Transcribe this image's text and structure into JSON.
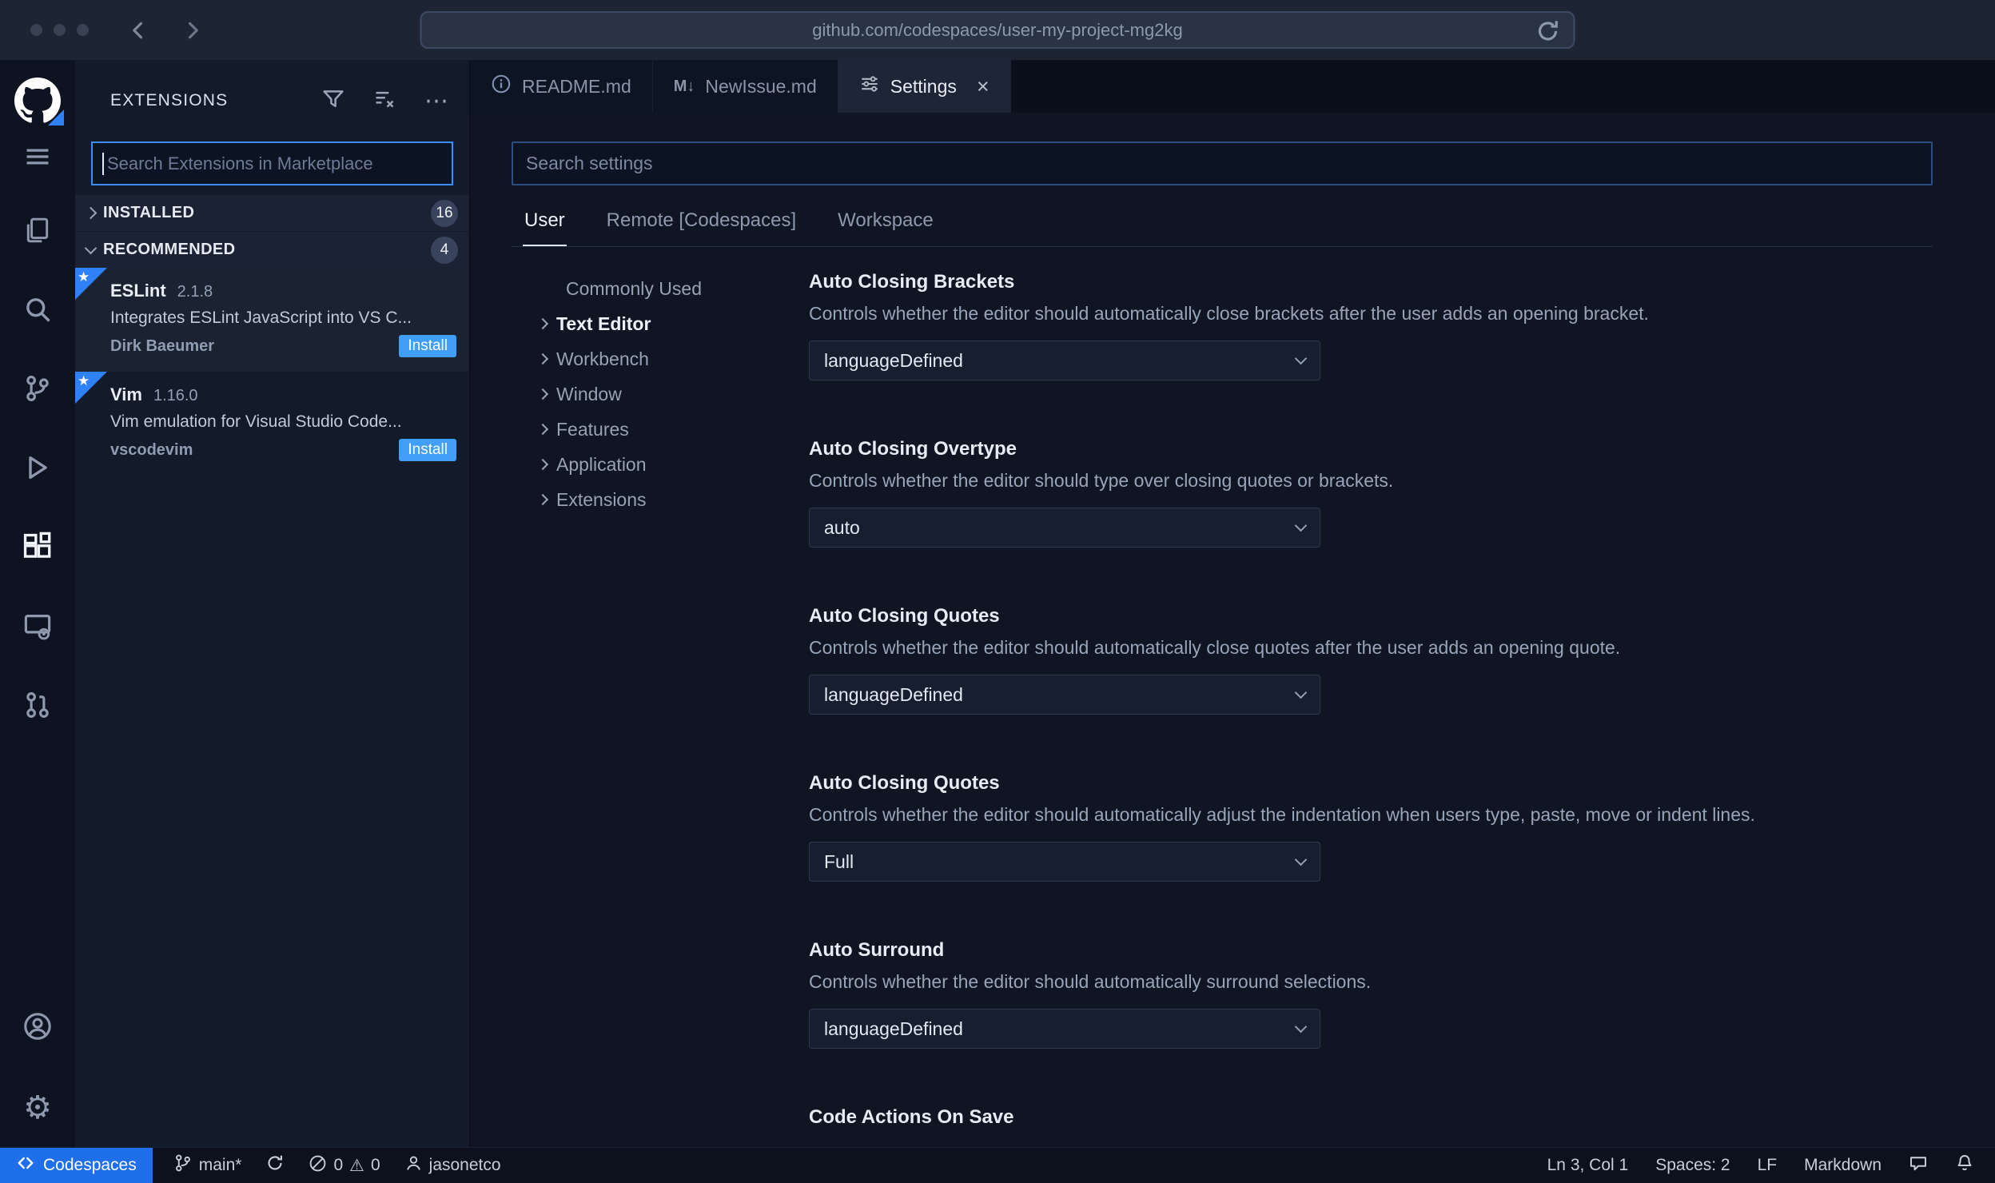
{
  "browser": {
    "url": "github.com/codespaces/user-my-project-mg2kg"
  },
  "sidebar": {
    "title": "EXTENSIONS",
    "search_placeholder": "Search Extensions in Marketplace",
    "sections": [
      {
        "label": "INSTALLED",
        "badge": "16"
      },
      {
        "label": "RECOMMENDED",
        "badge": "4"
      }
    ],
    "extensions": [
      {
        "name": "ESLint",
        "version": "2.1.8",
        "description": "Integrates ESLint JavaScript into VS C...",
        "author": "Dirk Baeumer",
        "action_label": "Install"
      },
      {
        "name": "Vim",
        "version": "1.16.0",
        "description": "Vim emulation for Visual Studio Code...",
        "author": "vscodevim",
        "action_label": "Install"
      }
    ]
  },
  "editor": {
    "tabs": [
      {
        "label": "README.md"
      },
      {
        "label": "NewIssue.md"
      },
      {
        "label": "Settings"
      }
    ],
    "settings": {
      "search_placeholder": "Search settings",
      "scopes": [
        {
          "label": "User"
        },
        {
          "label": "Remote [Codespaces]"
        },
        {
          "label": "Workspace"
        }
      ],
      "toc": [
        {
          "label": "Commonly Used"
        },
        {
          "label": "Text Editor"
        },
        {
          "label": "Workbench"
        },
        {
          "label": "Window"
        },
        {
          "label": "Features"
        },
        {
          "label": "Application"
        },
        {
          "label": "Extensions"
        }
      ],
      "items": [
        {
          "title": "Auto Closing Brackets",
          "description": "Controls whether the editor should automatically close brackets after the user adds an opening bracket.",
          "value": "languageDefined"
        },
        {
          "title": "Auto Closing Overtype",
          "description": "Controls whether the editor should type over closing quotes or brackets.",
          "value": "auto"
        },
        {
          "title": "Auto Closing Quotes",
          "description": "Controls whether the editor should automatically close quotes after the user adds an opening quote.",
          "value": "languageDefined"
        },
        {
          "title": "Auto Closing Quotes",
          "description": "Controls whether the editor should automatically adjust the indentation when users type, paste, move or indent lines.",
          "value": "Full"
        },
        {
          "title": "Auto Surround",
          "description": "Controls whether the editor should automatically surround selections.",
          "value": "languageDefined"
        },
        {
          "title": "Code Actions On Save",
          "description": "",
          "value": ""
        }
      ]
    }
  },
  "status_bar": {
    "codespaces": "Codespaces",
    "branch": "main*",
    "errors": "0",
    "warnings": "0",
    "user": "jasonetco",
    "line_col": "Ln 3, Col 1",
    "indent": "Spaces: 2",
    "eol": "LF",
    "language": "Markdown"
  },
  "icons": {
    "markdown_glyph": "M↓",
    "ellipsis": "⋯",
    "warning": "⚠",
    "gear": "⚙",
    "star": "★",
    "close": "×"
  },
  "colors": {
    "accent_blue": "#2f81f7",
    "install_blue": "#3f9ffa",
    "codespaces_blue": "#1f6feb"
  }
}
